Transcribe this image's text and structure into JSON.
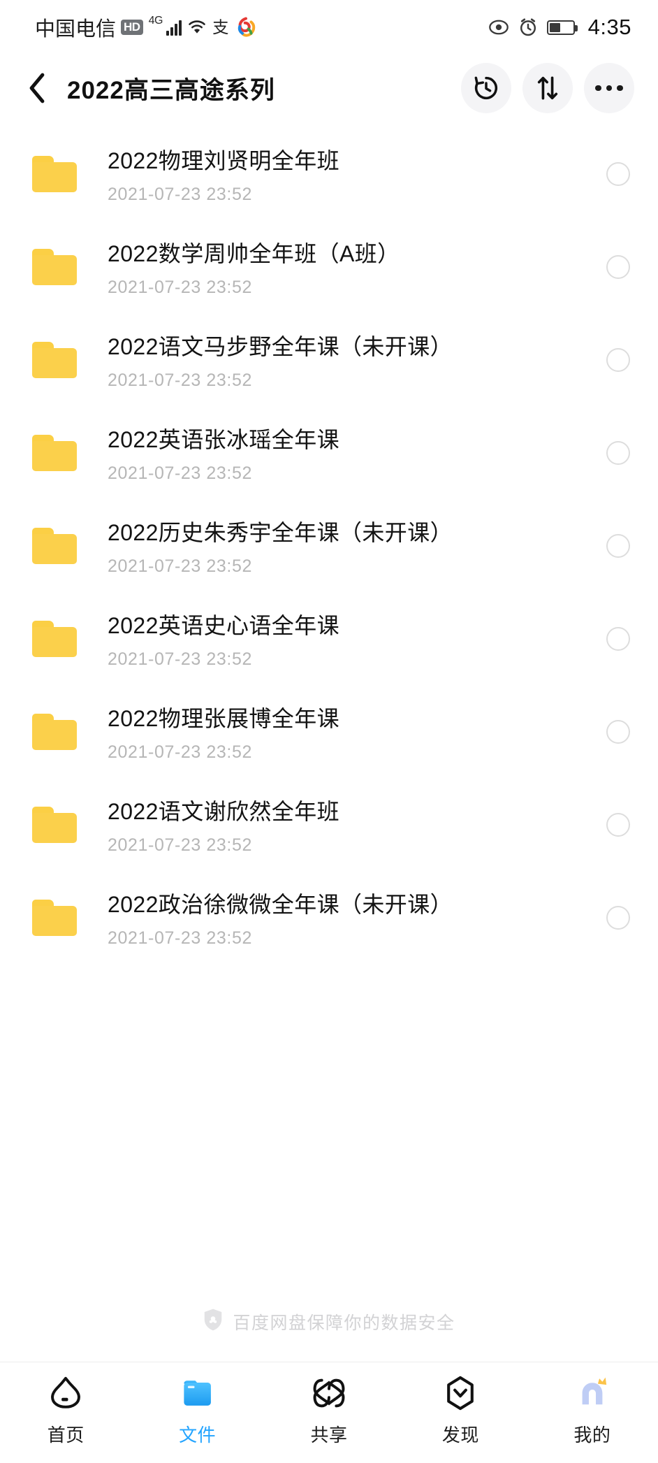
{
  "statusbar": {
    "carrier": "中国电信",
    "hd_badge": "HD",
    "network": "4G",
    "icons": [
      "signal-bars-icon",
      "wifi-icon",
      "alipay-icon",
      "app-logo-icon"
    ],
    "right_icons": [
      "eye-icon",
      "alarm-clock-icon",
      "battery-icon"
    ],
    "time": "4:35",
    "battery_level_percent": 42
  },
  "header": {
    "back_icon": "chevron-left-icon",
    "title": "2022高三高途系列",
    "actions": [
      {
        "name": "history",
        "icon": "history-clock-icon"
      },
      {
        "name": "sort",
        "icon": "sort-updown-icon"
      },
      {
        "name": "more",
        "icon": "more-dots-icon"
      }
    ]
  },
  "list": {
    "items": [
      {
        "icon": "folder-icon",
        "title": "2022物理刘贤明全年班",
        "date": "2021-07-23  23:52",
        "selected": false
      },
      {
        "icon": "folder-icon",
        "title": "2022数学周帅全年班（A班）",
        "date": "2021-07-23  23:52",
        "selected": false
      },
      {
        "icon": "folder-icon",
        "title": "2022语文马步野全年课（未开课）",
        "date": "2021-07-23  23:52",
        "selected": false
      },
      {
        "icon": "folder-icon",
        "title": "2022英语张冰瑶全年课",
        "date": "2021-07-23  23:52",
        "selected": false
      },
      {
        "icon": "folder-icon",
        "title": "2022历史朱秀宇全年课（未开课）",
        "date": "2021-07-23  23:52",
        "selected": false
      },
      {
        "icon": "folder-icon",
        "title": "2022英语史心语全年课",
        "date": "2021-07-23  23:52",
        "selected": false
      },
      {
        "icon": "folder-icon",
        "title": "2022物理张展博全年课",
        "date": "2021-07-23  23:52",
        "selected": false
      },
      {
        "icon": "folder-icon",
        "title": "2022语文谢欣然全年班",
        "date": "2021-07-23  23:52",
        "selected": false
      },
      {
        "icon": "folder-icon",
        "title": "2022政治徐微微全年课（未开课）",
        "date": "2021-07-23  23:52",
        "selected": false
      }
    ]
  },
  "safety_note": {
    "icon": "shield-baidu-icon",
    "text": "百度网盘保障你的数据安全"
  },
  "tabbar": {
    "active_index": 1,
    "tabs": [
      {
        "label": "首页",
        "icon": "cloud-icon"
      },
      {
        "label": "文件",
        "icon": "folder-filled-icon"
      },
      {
        "label": "共享",
        "icon": "share-infinity-icon"
      },
      {
        "label": "发现",
        "icon": "compass-hexagon-icon"
      },
      {
        "label": "我的",
        "icon": "avatar-crown-icon"
      }
    ]
  },
  "colors": {
    "folder_yellow": "#FBD04B",
    "accent_blue": "#23A4FF",
    "title_text": "#131313",
    "date_text": "#B6B6B6",
    "muted_text": "#D2D2D4"
  }
}
